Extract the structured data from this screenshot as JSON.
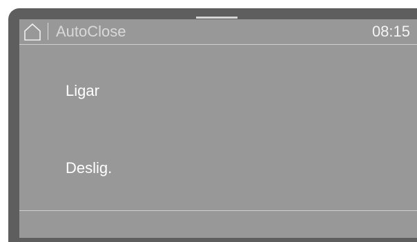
{
  "header": {
    "home_icon": "home-icon",
    "title": "AutoClose",
    "time": "08:15"
  },
  "options": [
    {
      "label": "Ligar"
    },
    {
      "label": "Deslig."
    }
  ],
  "colors": {
    "bezel": "#5e5e5e",
    "screen": "#989898",
    "text": "#ffffff",
    "title_text": "#d9d9d9",
    "rule": "#d0d0d0"
  }
}
